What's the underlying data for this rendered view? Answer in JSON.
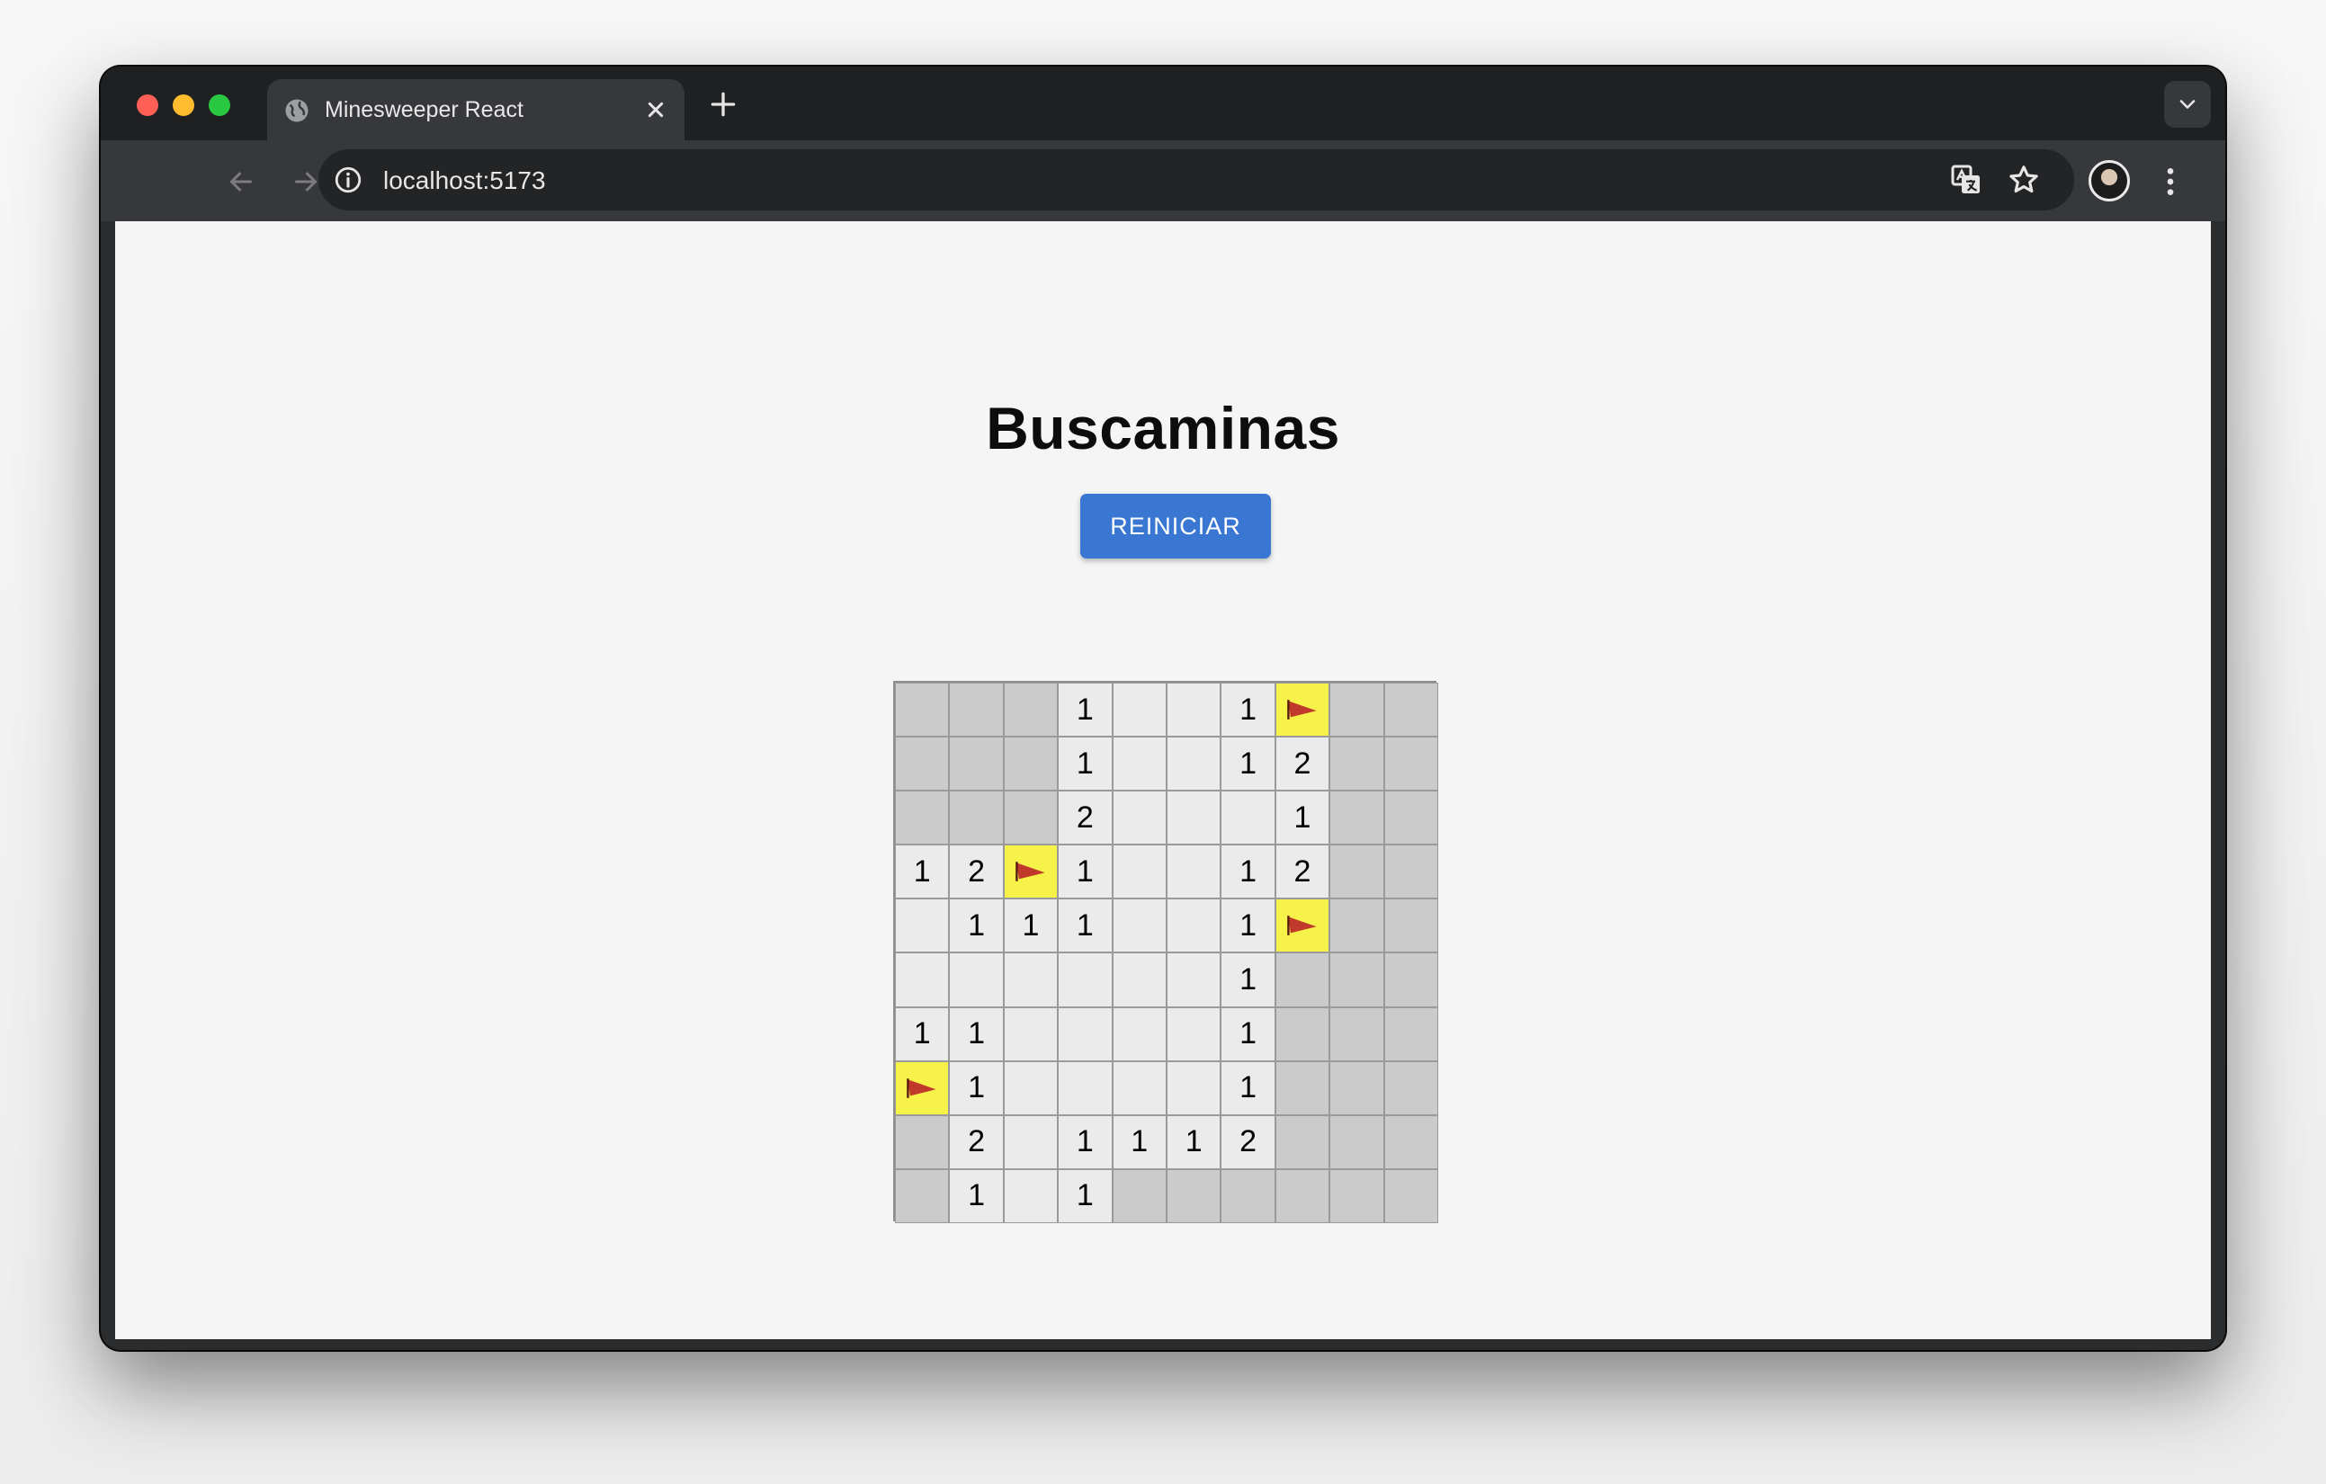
{
  "browser": {
    "tab_title": "Minesweeper React",
    "url": "localhost:5173"
  },
  "page": {
    "title": "Buscaminas",
    "reset_label": "REINICIAR"
  },
  "colors": {
    "button": "#3a77d3",
    "hidden_cell": "#cbcbcb",
    "open_cell": "#ebebeb",
    "flag_cell": "#f6f24a",
    "flag": "#c0392b"
  },
  "board": {
    "rows": [
      [
        "H",
        "H",
        "H",
        "1",
        "O",
        "O",
        "1",
        "F",
        "H",
        "H"
      ],
      [
        "H",
        "H",
        "H",
        "1",
        "O",
        "O",
        "1",
        "2",
        "H",
        "H"
      ],
      [
        "H",
        "H",
        "H",
        "2",
        "O",
        "O",
        "O",
        "1",
        "H",
        "H"
      ],
      [
        "1",
        "2",
        "F",
        "1",
        "O",
        "O",
        "1",
        "2",
        "H",
        "H"
      ],
      [
        "O",
        "1",
        "1",
        "1",
        "O",
        "O",
        "1",
        "F",
        "H",
        "H"
      ],
      [
        "O",
        "O",
        "O",
        "O",
        "O",
        "O",
        "1",
        "H",
        "H",
        "H"
      ],
      [
        "1",
        "1",
        "O",
        "O",
        "O",
        "O",
        "1",
        "H",
        "H",
        "H"
      ],
      [
        "F",
        "1",
        "O",
        "O",
        "O",
        "O",
        "1",
        "H",
        "H",
        "H"
      ],
      [
        "H",
        "2",
        "O",
        "1",
        "1",
        "1",
        "2",
        "H",
        "H",
        "H"
      ],
      [
        "H",
        "1",
        "O",
        "1",
        "H",
        "H",
        "H",
        "H",
        "H",
        "H"
      ]
    ]
  }
}
